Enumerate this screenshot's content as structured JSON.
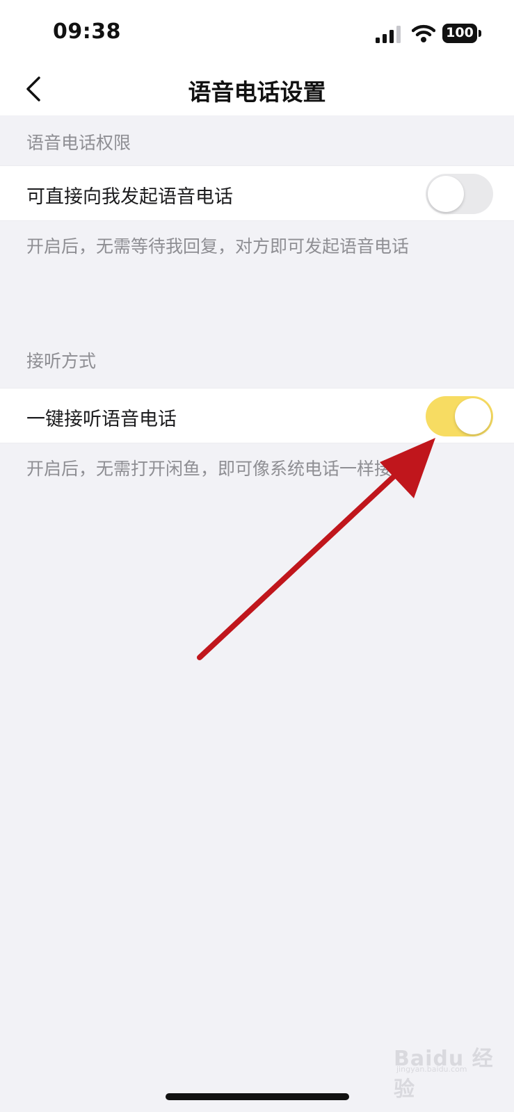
{
  "status_bar": {
    "time": "09:38",
    "battery": "100",
    "icons": [
      "signal-icon",
      "wifi-icon",
      "battery-icon"
    ]
  },
  "nav": {
    "title": "语音电话设置",
    "back_icon": "chevron-left-icon"
  },
  "sections": [
    {
      "header": "语音电话权限",
      "row_label": "可直接向我发起语音电话",
      "toggle_on": false,
      "description": "开启后，无需等待我回复，对方即可发起语音电话"
    },
    {
      "header": "接听方式",
      "row_label": "一键接听语音电话",
      "toggle_on": true,
      "description": "开启后，无需打开闲鱼，即可像系统电话一样接听"
    }
  ],
  "colors": {
    "background": "#f2f2f6",
    "toggle_on": "#f7dc62",
    "toggle_off": "#e9e9eb",
    "annotation_arrow": "#c0161c"
  },
  "watermark": {
    "text": "Baidu 经验",
    "sub": "jingyan.baidu.com"
  }
}
